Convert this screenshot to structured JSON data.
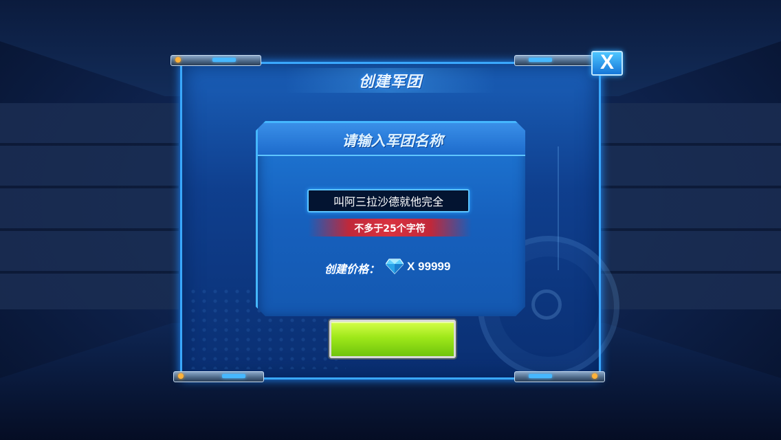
{
  "dialog": {
    "title": "创建军团",
    "close_label": "X"
  },
  "form": {
    "heading": "请输入军团名称",
    "name_value": "叫阿三拉沙德就他完全",
    "limit_hint": "不多于25个字符",
    "price_label": "创建价格：",
    "price_value": "X 99999",
    "currency_icon": "diamond-icon",
    "confirm_label": ""
  },
  "colors": {
    "panel_border": "#3aa8ff",
    "confirm_green": "#9fe81a",
    "warning_red": "#d8323f"
  }
}
